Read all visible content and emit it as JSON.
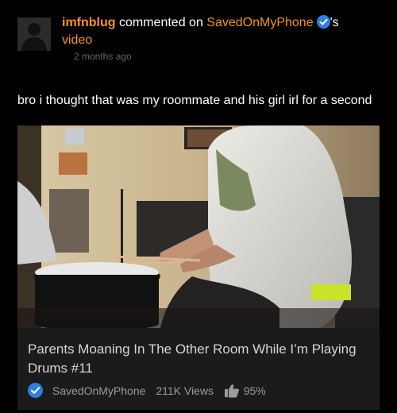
{
  "activity": {
    "username": "imfnblug",
    "action": "commented on",
    "target_user": "SavedOnMyPhone",
    "possessive": "'s",
    "object": "video",
    "timestamp": "2 months ago",
    "comment_text": "bro i thought that was my roommate and his girl irl for a second"
  },
  "video": {
    "title": "Parents Moaning In The Other Room While I’m Playing Drums #11",
    "channel": "SavedOnMyPhone",
    "views": "211K Views",
    "rating": "95%"
  },
  "icons": {
    "avatar": "default-avatar-icon",
    "verified": "verified-badge-icon",
    "rating": "thumbs-up-icon"
  },
  "colors": {
    "link": "#f7941d",
    "verified": "#2d7fe0",
    "background": "#000000",
    "card": "#1b1b1b"
  }
}
